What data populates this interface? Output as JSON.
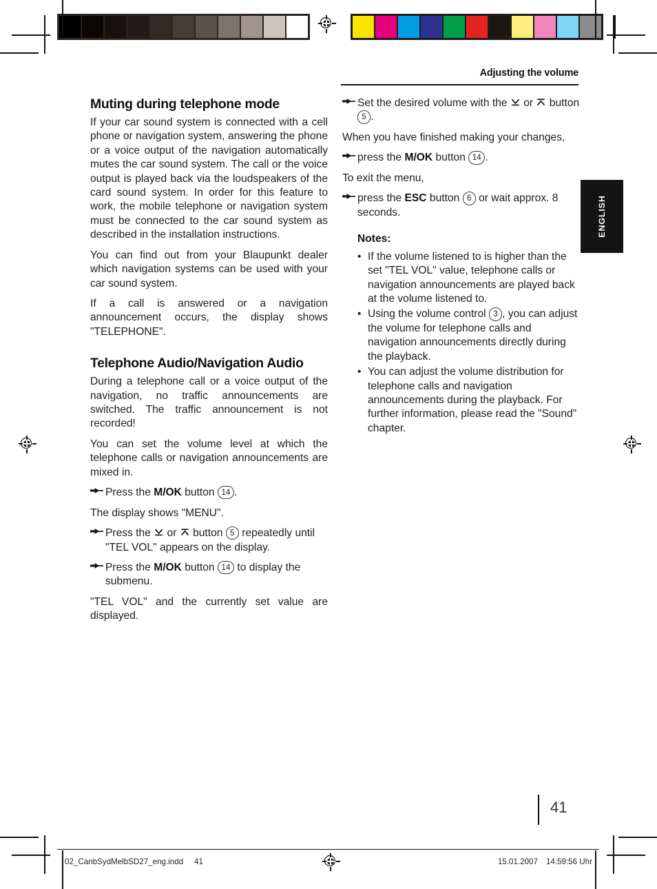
{
  "prepress": {
    "grayscale_patches": [
      "#000000",
      "#0c0806",
      "#16100e",
      "#231b19",
      "#332a27",
      "#463c38",
      "#5d524d",
      "#7e736d",
      "#a1948e",
      "#cfc3bf",
      "#ffffff"
    ],
    "color_patches": [
      "#fbe400",
      "#e6007e",
      "#009fe3",
      "#2e3192",
      "#00a04a",
      "#e52421",
      "#1b1715",
      "#fbee7a",
      "#f286bd",
      "#80d5f4",
      "#8c8c8c"
    ],
    "gray_strip_bg": "#2e2422",
    "color_strip_bg": "#211b1a"
  },
  "header": {
    "running_title": "Adjusting the volume"
  },
  "lang_tab": {
    "label": "ENGLISH"
  },
  "left_column": {
    "heading_1": "Muting during telephone mode",
    "para_1": "If your car sound system is connected with a cell phone or navigation system, answering the phone or a voice output of the navigation automatically mutes the car sound system. The call or the voice output is played back via the loudspeakers of the card sound system. In order for this feature to work, the mobile telephone or navigation system must be connected to the car sound system as described in the installation instructions.",
    "para_2": "You can find out from your Blaupunkt dealer which navigation systems can be used with your car sound system.",
    "para_3": "If a call is answered or a navigation announcement occurs, the display shows \"TELEPHONE\".",
    "heading_2": "Telephone Audio/Navigation Audio",
    "para_4": "During a telephone call or a voice output of the navigation, no traffic announcements are switched. The traffic announcement is not recorded!",
    "para_5": "You can set the volume level at which the telephone calls or navigation announcements are mixed in.",
    "step_1": {
      "prefix": "Press the ",
      "button": "M/OK",
      "mid": " button ",
      "ref": "14",
      "suffix": "."
    },
    "para_6": "The display shows \"MENU\".",
    "step_2": {
      "prefix": "Press the ",
      "mid_or": " or ",
      "mid": " button ",
      "ref": "5",
      "suffix": " repeatedly until \"TEL VOL\" appears on the display."
    },
    "step_3": {
      "prefix": "Press the ",
      "button": "M/OK",
      "mid": " button ",
      "ref": "14",
      "suffix": " to display the submenu."
    },
    "para_7": "\"TEL VOL\" and the currently set value are displayed."
  },
  "right_column": {
    "step_1": {
      "prefix": "Set the desired volume with the ",
      "mid_or": " or ",
      "mid": " button ",
      "ref": "5",
      "suffix": "."
    },
    "para_1": "When you have finished making your changes,",
    "step_2": {
      "prefix": "press the ",
      "button": "M/OK",
      "mid": " button ",
      "ref": "14",
      "suffix": "."
    },
    "para_2": "To exit the menu,",
    "step_3": {
      "prefix": "press the ",
      "button": "ESC",
      "mid": " button ",
      "ref": "6",
      "suffix": " or wait approx. 8 seconds."
    },
    "notes_heading": "Notes:",
    "notes": [
      {
        "text": "If the volume listened to is higher than the set \"TEL VOL\" value, telephone calls or navigation announcements are played back at the volume listened to.",
        "bullet": "•"
      },
      {
        "prefix": "Using the volume control ",
        "ref": "3",
        "suffix": ", you can adjust the volume for telephone calls and navigation announcements directly during the playback.",
        "bullet": "•"
      },
      {
        "text": "You can adjust the volume distribution for telephone calls and navigation announcements during the playback. For further information, please read the \"Sound\" chapter.",
        "bullet": "•"
      }
    ]
  },
  "folio": {
    "page_number": "41"
  },
  "footer": {
    "filename": "02_CanbSydMelbSD27_eng.indd",
    "page": "41",
    "date": "15.01.2007",
    "time": "14:59:56 Uhr"
  }
}
